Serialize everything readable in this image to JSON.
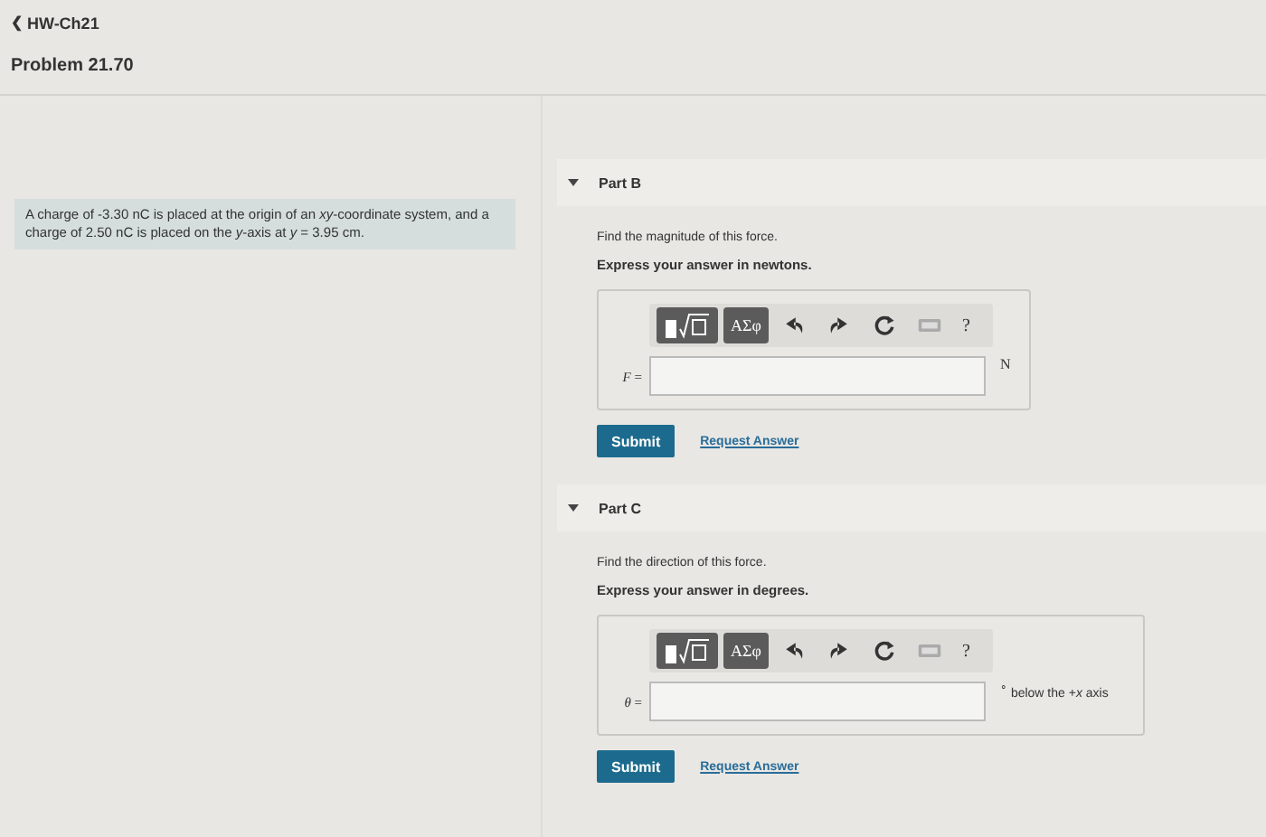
{
  "breadcrumb": "HW-Ch21",
  "back_icon": "❮",
  "title": "Problem 21.70",
  "problem": "A charge of -3.30 nC is placed at the origin of an *xy*-coordinate system, and a charge of 2.50 nC is placed on the *y*-axis at *y* = 3.95 cm.",
  "parts": [
    {
      "label": "Part B",
      "expanded": true,
      "instruction": "Find the magnitude of this force.",
      "emphasis": "Express your answer in newtons.",
      "toolbar": {
        "greek": "ΑΣφ",
        "help": "?"
      },
      "variable": "*F* =",
      "unit": "N",
      "submit": "Submit",
      "request": "Request Answer"
    },
    {
      "label": "Part C",
      "expanded": true,
      "instruction": "Find the direction of this force.",
      "emphasis": "Express your answer in degrees.",
      "toolbar": {
        "greek": "ΑΣφ",
        "help": "?"
      },
      "variable": "*θ* =",
      "unit": "$^{∘}$ below the +*x* axis",
      "submit": "Submit",
      "request": "Request Answer"
    }
  ]
}
